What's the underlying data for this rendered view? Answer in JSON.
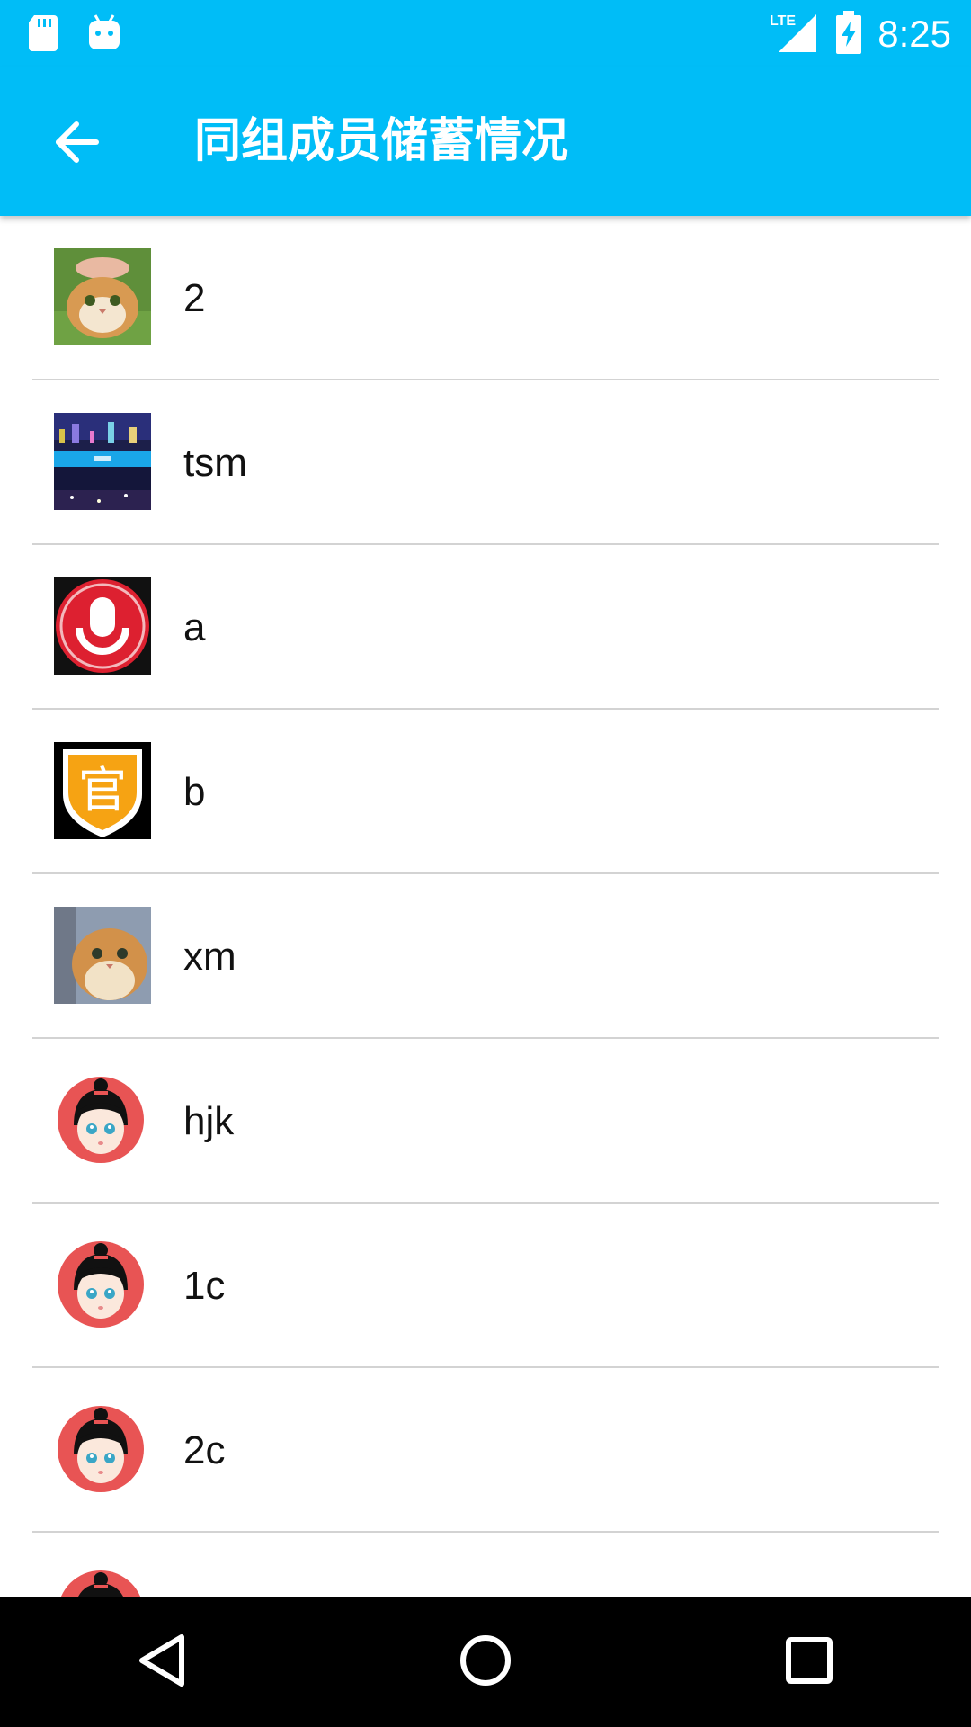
{
  "status_bar": {
    "time": "8:25",
    "network": "LTE",
    "icons": [
      "sd-card-icon",
      "android-icon",
      "lte-signal-icon",
      "battery-charging-icon"
    ]
  },
  "app_bar": {
    "title": "同组成员储蓄情况",
    "back_icon": "arrow-back-icon"
  },
  "members": [
    {
      "name": "2",
      "avatar": "cat-photo"
    },
    {
      "name": "tsm",
      "avatar": "city-night-photo"
    },
    {
      "name": "a",
      "avatar": "red-mic-logo"
    },
    {
      "name": "b",
      "avatar": "official-badge",
      "avatar_text": "官"
    },
    {
      "name": "xm",
      "avatar": "cat-photo-2"
    },
    {
      "name": "hjk",
      "avatar": "default-girl-avatar"
    },
    {
      "name": "1c",
      "avatar": "default-girl-avatar"
    },
    {
      "name": "2c",
      "avatar": "default-girl-avatar"
    }
  ],
  "nav_bar": {
    "icons": [
      "back-triangle-icon",
      "home-circle-icon",
      "recents-square-icon"
    ]
  },
  "colors": {
    "primary": "#00bdf7",
    "divider": "#d3d3d3",
    "avatar_red": "#e85454"
  }
}
